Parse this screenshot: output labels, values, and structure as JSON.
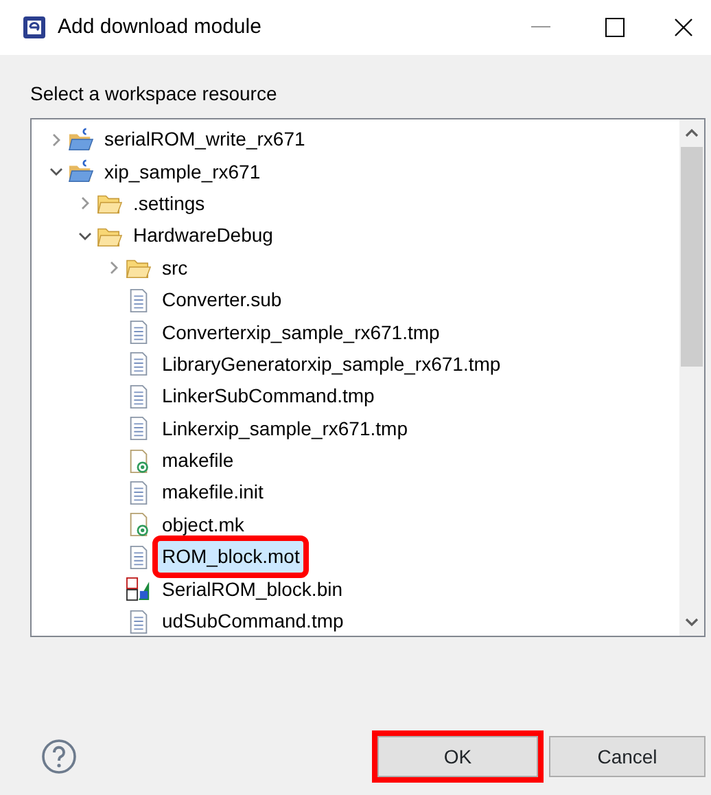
{
  "window": {
    "title": "Add download module"
  },
  "prompt": "Select a workspace resource",
  "tree": [
    {
      "label": "serialROM_write_rx671",
      "kind": "project",
      "expanded": false,
      "selected": false,
      "highlighted": false
    },
    {
      "label": "xip_sample_rx671",
      "kind": "project",
      "expanded": true,
      "selected": false,
      "highlighted": false,
      "children": [
        {
          "label": ".settings",
          "kind": "folder",
          "expanded": false,
          "selected": false,
          "highlighted": false
        },
        {
          "label": "HardwareDebug",
          "kind": "folder",
          "expanded": true,
          "selected": false,
          "highlighted": false,
          "children": [
            {
              "label": "src",
              "kind": "folder",
              "expanded": false,
              "selected": false,
              "highlighted": false
            },
            {
              "label": "Converter.sub",
              "kind": "file",
              "selected": false,
              "highlighted": false
            },
            {
              "label": "Converterxip_sample_rx671.tmp",
              "kind": "file",
              "selected": false,
              "highlighted": false
            },
            {
              "label": "LibraryGeneratorxip_sample_rx671.tmp",
              "kind": "file",
              "selected": false,
              "highlighted": false
            },
            {
              "label": "LinkerSubCommand.tmp",
              "kind": "file",
              "selected": false,
              "highlighted": false
            },
            {
              "label": "Linkerxip_sample_rx671.tmp",
              "kind": "file",
              "selected": false,
              "highlighted": false
            },
            {
              "label": "makefile",
              "kind": "makefile",
              "selected": false,
              "highlighted": false
            },
            {
              "label": "makefile.init",
              "kind": "file",
              "selected": false,
              "highlighted": false
            },
            {
              "label": "object.mk",
              "kind": "makefile",
              "selected": false,
              "highlighted": false
            },
            {
              "label": "ROM_block.mot",
              "kind": "file",
              "selected": true,
              "highlighted": true
            },
            {
              "label": "SerialROM_block.bin",
              "kind": "binary",
              "selected": false,
              "highlighted": false
            },
            {
              "label": "udSubCommand.tmp",
              "kind": "file",
              "selected": false,
              "highlighted": false
            }
          ]
        }
      ]
    }
  ],
  "buttons": [
    {
      "label": "OK",
      "highlighted": true
    },
    {
      "label": "Cancel",
      "highlighted": false
    }
  ]
}
